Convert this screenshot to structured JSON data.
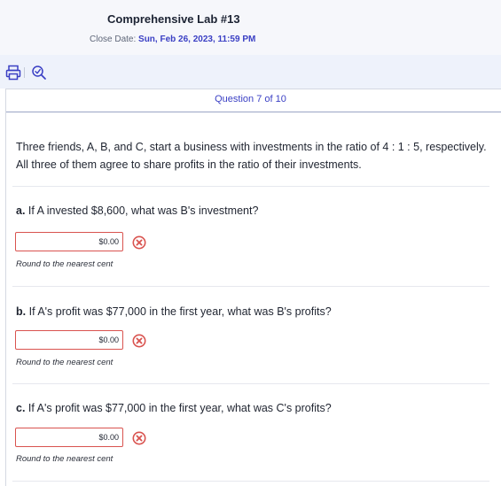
{
  "header": {
    "title": "Comprehensive Lab #13",
    "close_label": "Close Date:",
    "close_date": "Sun, Feb 26, 2023, 11:59 PM"
  },
  "toolbar": {
    "icons": [
      "print-icon",
      "search-check-icon"
    ]
  },
  "question": {
    "number_label": "Question 7 of 10",
    "intro": "Three friends, A, B, and C, start a business with investments in the ratio of 4 : 1 : 5, respectively. All three of them agree to share profits in the ratio of their investments.",
    "parts": [
      {
        "letter": "a.",
        "text": "If A invested $8,600, what was B's investment?",
        "value": "$0.00",
        "hint": "Round to the nearest cent",
        "status": "incorrect"
      },
      {
        "letter": "b.",
        "text": "If A's profit was $77,000 in the first year, what was B's profits?",
        "value": "$0.00",
        "hint": "Round to the nearest cent",
        "status": "incorrect"
      },
      {
        "letter": "c.",
        "text": "If A's profit was $77,000 in the first year, what was C's profits?",
        "value": "$0.00",
        "hint": "Round to the nearest cent",
        "status": "incorrect"
      }
    ]
  },
  "colors": {
    "accent": "#3a3fc4",
    "error": "#d9534f",
    "header_bg": "#f6f7fb",
    "toolbar_bg": "#eef2fb"
  }
}
